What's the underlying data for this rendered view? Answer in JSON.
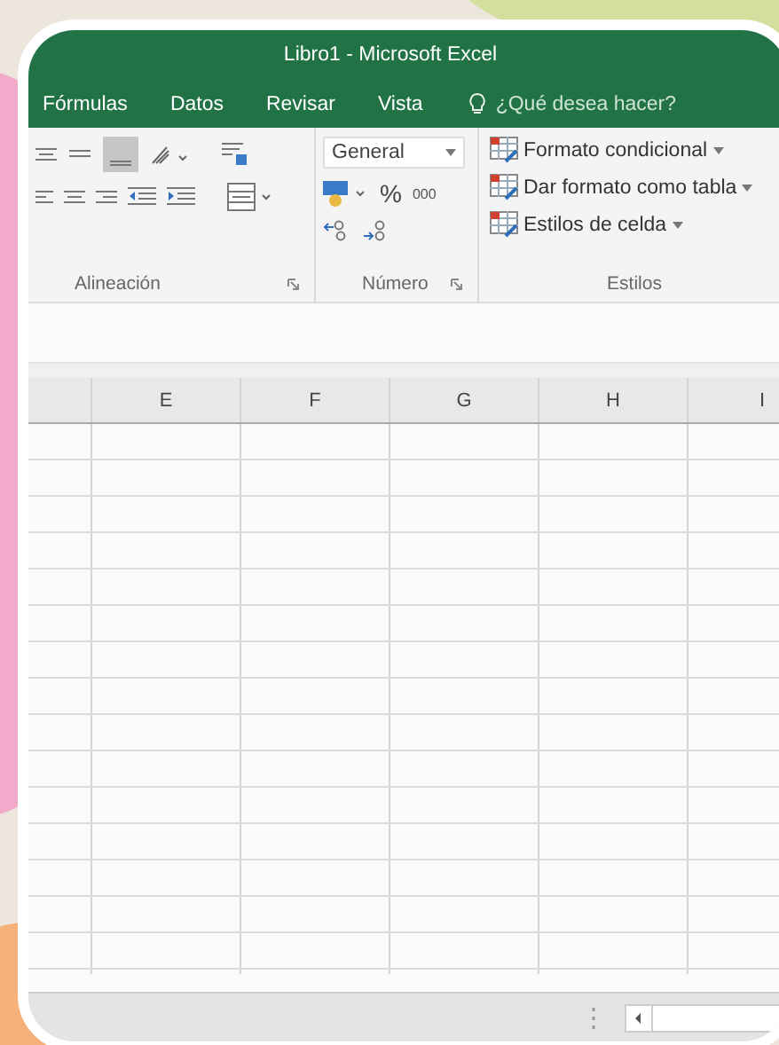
{
  "window": {
    "title": "Libro1 - Microsoft Excel"
  },
  "tabs": [
    {
      "label": "Fórmulas"
    },
    {
      "label": "Datos"
    },
    {
      "label": "Revisar"
    },
    {
      "label": "Vista"
    }
  ],
  "tell_me": {
    "placeholder": "¿Qué desea hacer?"
  },
  "ribbon": {
    "alignment": {
      "label": "Alineación"
    },
    "number": {
      "format": "General",
      "percent": "%",
      "thousands": "000",
      "label": "Número"
    },
    "styles": {
      "items": [
        "Formato condicional",
        "Dar formato como tabla",
        "Estilos de celda"
      ],
      "label": "Estilos"
    }
  },
  "sheet": {
    "columns": [
      "E",
      "F",
      "G",
      "H",
      "I"
    ]
  }
}
